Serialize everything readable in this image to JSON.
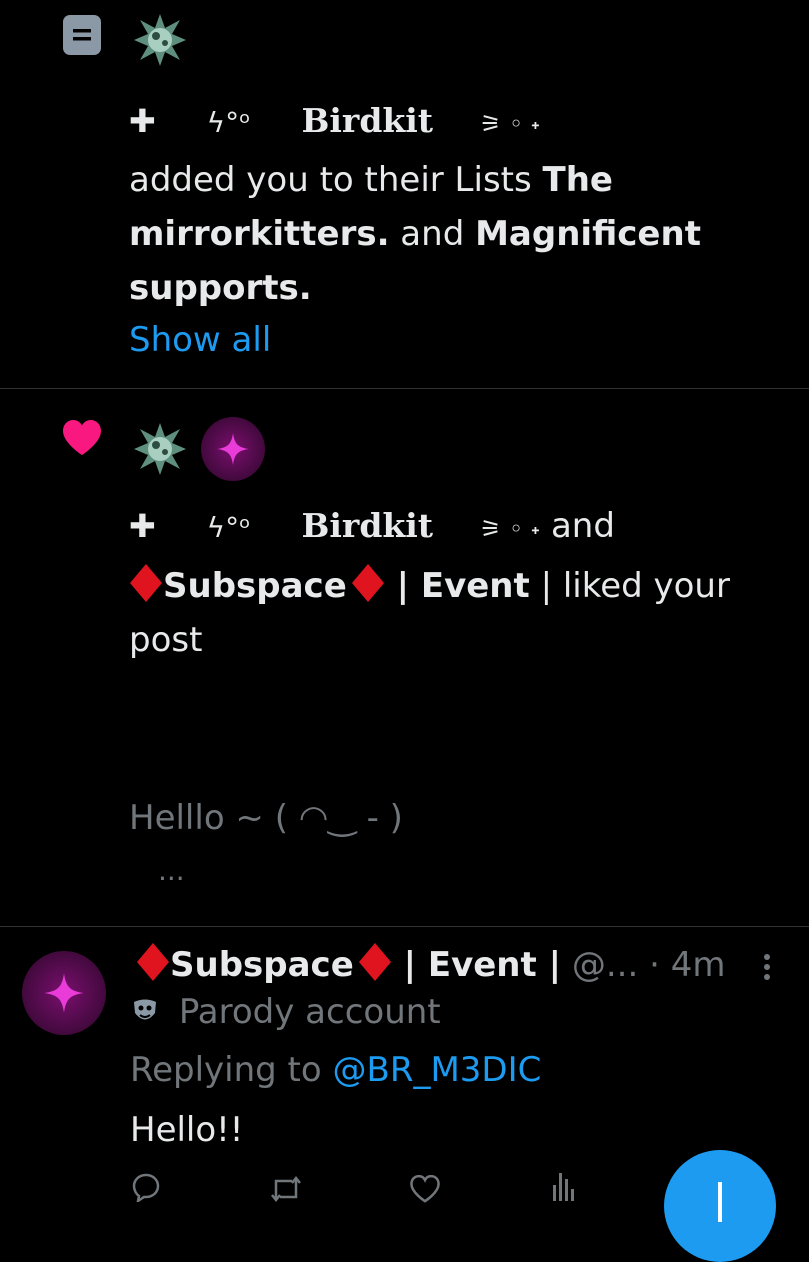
{
  "notification1": {
    "name_plus": "✚",
    "name_glyphs": "ϟ°ᵒ",
    "name": "Birdkit",
    "name_tail": "⚞ ◦ ˖",
    "message_prefix": "added you to their Lists ",
    "list1": "The mirrorkitters.",
    "joiner": " and ",
    "list2": "Magnificent supports.",
    "show_all": "Show all"
  },
  "notification2": {
    "name_plus": "✚",
    "name_glyphs": "ϟ°ᵒ",
    "name": "Birdkit",
    "name_tail": "⚞ ◦ ˖",
    "and": "and",
    "second_name": "Subspace",
    "second_suffix": " | Event",
    "action": " | liked your post",
    "post_preview": "Helllo ~ ( ◠‿ - )",
    "more": "..."
  },
  "reply": {
    "author_name": "Subspace",
    "author_suffix": " | Event |",
    "handle": " @...",
    "time": " · 4m",
    "parody_label": "Parody account",
    "replying_prefix": "Replying to ",
    "replying_handle": "@BR_M3DIC",
    "body": "Hello!!"
  },
  "colors": {
    "accent": "#1d9bf0",
    "heart": "#f91880",
    "diamond": "#e0141e"
  }
}
